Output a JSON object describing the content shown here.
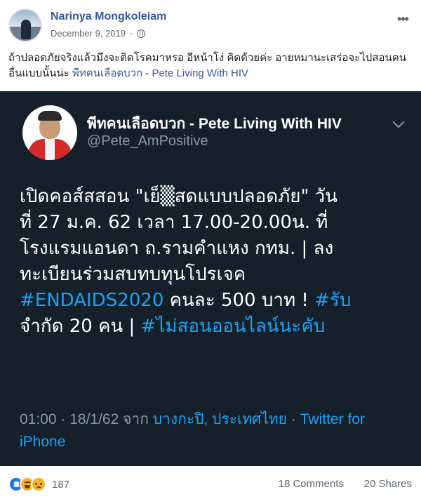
{
  "post": {
    "author": "Narinya Mongkoleiam",
    "date": "December 9, 2019",
    "separator": "·",
    "privacy_icon": "globe-icon",
    "more_icon": "more-icon",
    "caption_text": "ถ้าปลอดภัยจริงแล้วมึงจะติดโรคมาหรอ อีหน้าโง่ คิดด้วยค่ะ อายหมานะเสร่อจะไปสอนคนอื่นแบบนั้นน่ะ ",
    "caption_link": "พีทคนเลือดบวก - Pete Living With HIV"
  },
  "tweet": {
    "name": "พีทคนเลือดบวก - Pete Living With HIV",
    "handle": "@Pete_AmPositive",
    "line1": "เปิดคอส์สสอน \"เย็▒สดแบบปลอดภัย\" วัน",
    "line2": "ที่ 27 ม.ค. 62 เวลา 17.00-20.00น. ที่",
    "line3": "โรงแรมแอนดา ถ.รามคำแหง กทม. | ลง",
    "line4": "ทะเบียนร่วมสบทบทุนโปรเจค",
    "line5_hashtag": "#ENDAIDS2020",
    "line5_text": " คนละ 500 บาท ! ",
    "line5_hashtag2": "#รับ",
    "line6_text": "จำกัด 20 คน | ",
    "line6_hashtag": "#ไม่สอนออนไลน์นะคับ",
    "time_date": "01:00 · 18/1/62 จาก ",
    "location": "บางกะปิ, ประเทศไทย",
    "dot": " · ",
    "client": "Twitter for iPhone"
  },
  "footer": {
    "reaction_icons": [
      "like-icon",
      "haha-icon",
      "sad-icon"
    ],
    "reaction_count": "187",
    "comments": "18 Comments",
    "shares": "20 Shares"
  },
  "colors": {
    "link": "#385898",
    "tweet_bg": "#15202b",
    "twitter_blue": "#1da1f2",
    "muted": "#606770"
  }
}
